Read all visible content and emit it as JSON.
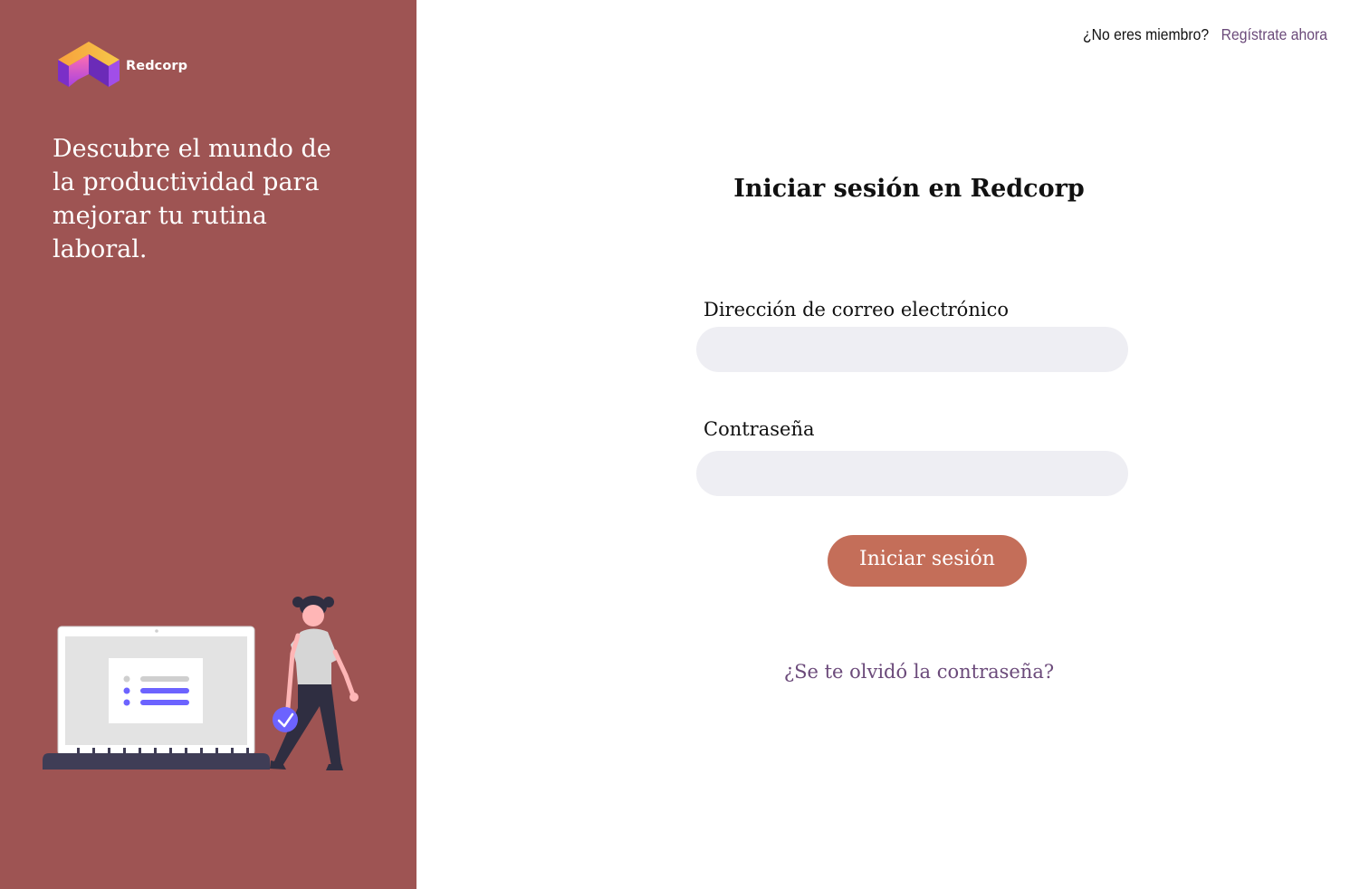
{
  "brand": {
    "name": "Redcorp",
    "logo_icon": "cube-logo-icon"
  },
  "sidebar": {
    "tagline": "Descubre el mundo de la productividad para mejorar tu rutina laboral.",
    "illustration": "person-with-laptop-illustration",
    "background_color": "#9e5453"
  },
  "header": {
    "question": "¿No eres miembro?",
    "signup_link": "Regístrate ahora"
  },
  "login": {
    "title": "Iniciar sesión en Redcorp",
    "email_label": "Dirección de correo electrónico",
    "email_value": "",
    "password_label": "Contraseña",
    "password_value": "",
    "submit_label": "Iniciar sesión",
    "forgot_link": "¿Se te olvidó la contraseña?",
    "button_color": "#c46e59",
    "link_color": "#6b4a7a"
  }
}
